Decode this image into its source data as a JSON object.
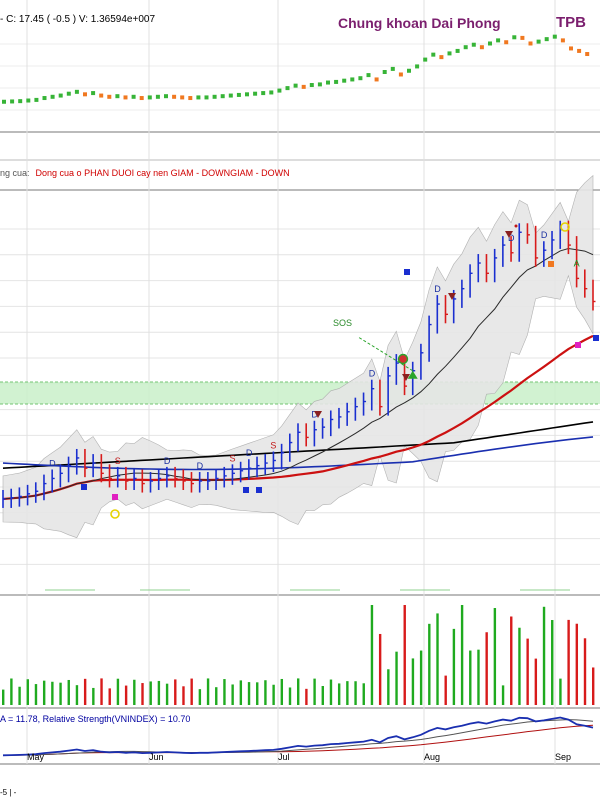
{
  "header": {
    "info": "- C: 17.45 ( -0.5 ) V: 1.36594e+007",
    "brand": "Chung khoan Dai Phong",
    "ticker": "TPB"
  },
  "signal_bar": {
    "label": "ng cua:",
    "text": "Dong cua o PHAN DUOI cay nen GIAM - DOWNGIAM - DOWN"
  },
  "sos_label": "SOS",
  "rs_label": "A = 11.78, Relative Strength(VNINDEX) = 10.70",
  "bottom_note": "-5 | -",
  "colors": {
    "up": "#1a2fd0",
    "down": "#d81b1b",
    "ma_fast": "#2a2a2a",
    "ma_slow": "#cc1111",
    "ma_long_black": "#000000",
    "ma_long_blue": "#1a2fb0",
    "band_fill": "#e6e6e6",
    "zone_fill": "#c9f0c9",
    "vol_up": "#1faa1f",
    "vol_down": "#d81b1b",
    "overview_up": "#37b437",
    "overview_down": "#f07820",
    "brand": "#7b1f6e"
  },
  "chart_data": {
    "type": "line",
    "symbol": "TPB",
    "months": [
      "May",
      "Jun",
      "Jul",
      "Aug",
      "Sep"
    ],
    "close": [
      10.2,
      10.25,
      10.3,
      10.4,
      10.5,
      10.8,
      11.0,
      11.2,
      11.5,
      11.8,
      11.4,
      11.6,
      11.2,
      11.0,
      11.1,
      10.9,
      11.0,
      10.8,
      10.9,
      11.0,
      11.1,
      11.0,
      10.9,
      10.8,
      10.9,
      10.9,
      11.0,
      11.1,
      11.2,
      11.3,
      11.4,
      11.5,
      11.6,
      11.7,
      12.0,
      12.4,
      12.8,
      12.6,
      12.9,
      13.0,
      13.3,
      13.4,
      13.6,
      13.8,
      14.0,
      14.5,
      13.8,
      15.0,
      15.5,
      14.6,
      15.2,
      15.9,
      17.0,
      17.8,
      17.4,
      18.0,
      18.4,
      19.0,
      19.4,
      19.0,
      19.6,
      20.1,
      19.8,
      20.6,
      20.5,
      19.6,
      19.9,
      20.3,
      20.7,
      20.1,
      18.8,
      18.4,
      17.9
    ],
    "events": [
      "D",
      "D",
      "S",
      "D",
      "S",
      "D",
      "S",
      "D",
      "D",
      "SOS",
      "D",
      "D",
      "D",
      "A"
    ]
  }
}
